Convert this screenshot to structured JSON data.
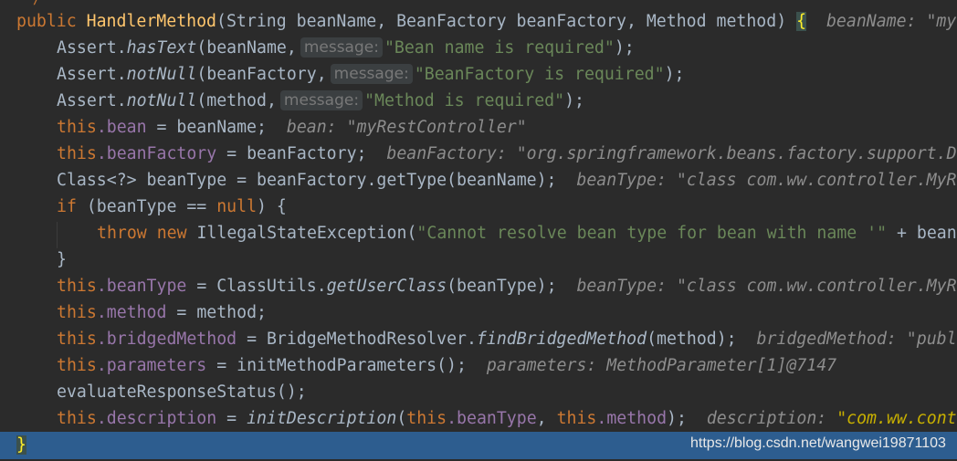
{
  "code": {
    "partial_top": "/",
    "line1": {
      "kw_public": "public",
      "method_name": "HandlerMethod",
      "params": "(String beanName, BeanFactory beanFactory, Method method) ",
      "open_brace": "{",
      "inline_value": "beanName: \"my"
    },
    "line2": {
      "prefix": "Assert.",
      "method": "hasText",
      "args": "(beanName,",
      "hint": "message:",
      "string": "\"Bean name is required\"",
      "suffix": ");"
    },
    "line3": {
      "prefix": "Assert.",
      "method": "notNull",
      "args": "(beanFactory,",
      "hint": "message:",
      "string": "\"BeanFactory is required\"",
      "suffix": ");"
    },
    "line4": {
      "prefix": "Assert.",
      "method": "notNull",
      "args": "(method,",
      "hint": "message:",
      "string": "\"Method is required\"",
      "suffix": ");"
    },
    "line5": {
      "this_kw": "this",
      "field": ".bean",
      "rest": " = beanName;",
      "inline_value": "bean: \"myRestController\""
    },
    "line6": {
      "this_kw": "this",
      "field": ".beanFactory",
      "rest": " = beanFactory;",
      "inline_value": "beanFactory: \"org.springframework.beans.factory.support.D"
    },
    "line7": {
      "code": "Class<?> beanType = beanFactory.getType(beanName);",
      "inline_value": "beanType: \"class com.ww.controller.MyR"
    },
    "line8": {
      "if_kw": "if",
      "cond": " (beanType == ",
      "null_kw": "null",
      "rest": ") {"
    },
    "line9": {
      "throw_kw": "throw",
      "new_kw": "new",
      "cls": " IllegalStateException(",
      "string": "\"Cannot resolve bean type for bean with name '\"",
      "rest": " + bean"
    },
    "line10": {
      "close": "}"
    },
    "line11": {
      "this_kw": "this",
      "field": ".beanType",
      "mid": " = ClassUtils.",
      "method": "getUserClass",
      "rest": "(beanType);",
      "inline_value": "beanType: \"class com.ww.controller.MyR"
    },
    "line12": {
      "this_kw": "this",
      "field": ".method",
      "rest": " = method;"
    },
    "line13": {
      "this_kw": "this",
      "field": ".bridgedMethod",
      "mid": " = BridgeMethodResolver.",
      "method": "findBridgedMethod",
      "rest": "(method);",
      "inline_value": "bridgedMethod: \"publ"
    },
    "line14": {
      "this_kw": "this",
      "field": ".parameters",
      "rest": " = initMethodParameters();",
      "inline_value": "parameters: MethodParameter[1]@7147"
    },
    "line15": {
      "code": "evaluateResponseStatus();"
    },
    "line16": {
      "this_kw": "this",
      "field": ".description",
      "eq": " = ",
      "method": "initDescription",
      "paren_open": "(",
      "this_kw2": "this",
      "field2": ".beanType",
      "comma": ", ",
      "this_kw3": "this",
      "field3": ".method",
      "rest": ");",
      "inline_value_label": "description:",
      "inline_value_str": "\"com.ww.cont"
    },
    "line17": {
      "close": "}"
    }
  },
  "watermark": "https://blog.csdn.net/wangwei19871103",
  "colors": {
    "background": "#2b2b2b",
    "keyword": "#cc7832",
    "method_decl": "#ffc66d",
    "string": "#6a8759",
    "field": "#9876aa",
    "default_text": "#a9b7c6",
    "current_line": "#2d5d8f"
  }
}
